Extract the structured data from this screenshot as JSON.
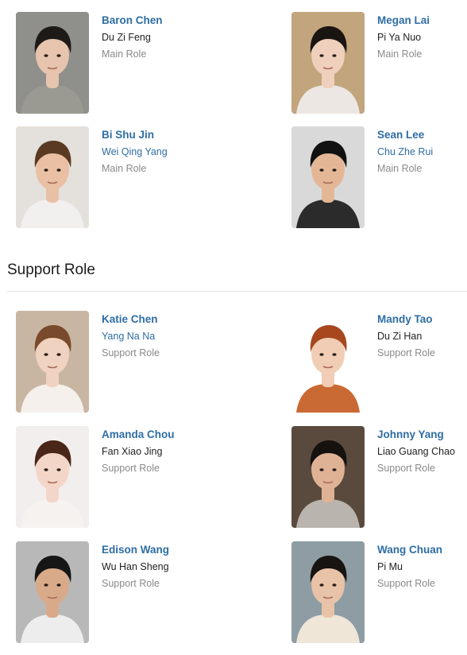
{
  "main_cast": [
    {
      "actor": "Baron Chen",
      "character": "Du Zi Feng",
      "character_linked": false,
      "role": "Main Role",
      "photo": {
        "bg": "#8f8f8b",
        "skin": "#e6c4ad",
        "hair": "#1e1a18",
        "shirt": "#9a9a92"
      }
    },
    {
      "actor": "Megan Lai",
      "character": "Pi Ya Nuo",
      "character_linked": false,
      "role": "Main Role",
      "photo": {
        "bg": "#c2a57c",
        "skin": "#efd0bd",
        "hair": "#1a1412",
        "shirt": "#ece7e2"
      }
    },
    {
      "actor": "Bi Shu Jin",
      "character": "Wei Qing Yang",
      "character_linked": true,
      "role": "Main Role",
      "photo": {
        "bg": "#e4e0dc",
        "skin": "#e9c0a4",
        "hair": "#5a3a22",
        "shirt": "#f2f0ee"
      }
    },
    {
      "actor": "Sean Lee",
      "character": "Chu Zhe Rui",
      "character_linked": true,
      "role": "Main Role",
      "photo": {
        "bg": "#d9d9d9",
        "skin": "#e3b796",
        "hair": "#111111",
        "shirt": "#2b2b2b"
      }
    }
  ],
  "support_section": {
    "title": "Support Role"
  },
  "support_cast": [
    {
      "actor": "Katie Chen",
      "character": "Yang Na Na",
      "character_linked": true,
      "role": "Support Role",
      "photo": {
        "bg": "#c9b6a2",
        "skin": "#f0d2c0",
        "hair": "#7a4a2c",
        "shirt": "#f5f0ec"
      }
    },
    {
      "actor": "Mandy Tao",
      "character": "Du Zi Han",
      "character_linked": false,
      "role": "Support Role",
      "photo": {
        "bg": "#ffffff",
        "skin": "#f0cdb4",
        "hair": "#a8471e",
        "shirt": "#c96a35"
      }
    },
    {
      "actor": "Amanda Chou",
      "character": "Fan Xiao Jing",
      "character_linked": false,
      "role": "Support Role",
      "photo": {
        "bg": "#f3eeee",
        "skin": "#f3d6c8",
        "hair": "#4a2618",
        "shirt": "#f6f2f0"
      }
    },
    {
      "actor": "Johnny Yang",
      "character": "Liao Guang Chao",
      "character_linked": false,
      "role": "Support Role",
      "photo": {
        "bg": "#5a4a3e",
        "skin": "#e0b295",
        "hair": "#151210",
        "shirt": "#b9b4ad"
      }
    },
    {
      "actor": "Edison Wang",
      "character": "Wu Han Sheng",
      "character_linked": false,
      "role": "Support Role",
      "photo": {
        "bg": "#b8b8b8",
        "skin": "#d9aa8a",
        "hair": "#161616",
        "shirt": "#ededed"
      }
    },
    {
      "actor": "Wang Chuan",
      "character": "Pi Mu",
      "character_linked": false,
      "role": "Support Role",
      "photo": {
        "bg": "#8e9da3",
        "skin": "#e8c3a8",
        "hair": "#171412",
        "shirt": "#efe6d8"
      }
    }
  ]
}
